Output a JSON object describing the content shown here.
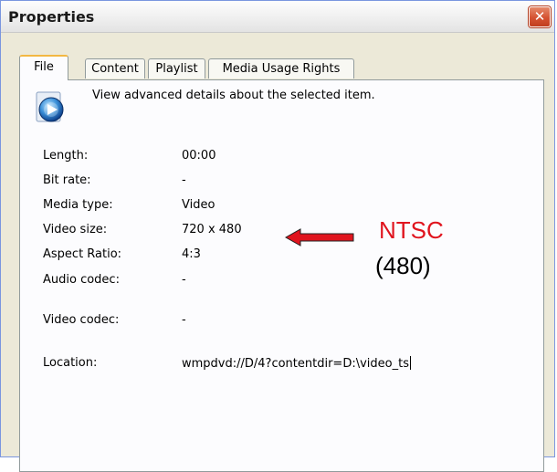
{
  "window": {
    "title": "Properties",
    "close_glyph": "✕"
  },
  "tabs": [
    {
      "label": "File",
      "active": true
    },
    {
      "label": "Content",
      "active": false
    },
    {
      "label": "Playlist",
      "active": false
    },
    {
      "label": "Media Usage Rights",
      "active": false
    }
  ],
  "header": {
    "icon": "windows-media-player-icon",
    "text": "View advanced details about the selected item."
  },
  "details": [
    {
      "label": "Length:",
      "value": "00:00"
    },
    {
      "label": "Bit rate:",
      "value": "-"
    },
    {
      "label": "Media type:",
      "value": "Video"
    },
    {
      "label": "Video size:",
      "value": "720 x 480"
    },
    {
      "label": "Aspect Ratio:",
      "value": "4:3"
    },
    {
      "label": "Audio codec:",
      "value": "-"
    },
    {
      "label": "Video codec:",
      "value": "-"
    },
    {
      "label": "Location:",
      "value": "wmpdvd://D/4?contentdir=D:\\video_ts"
    }
  ],
  "annotation": {
    "line1": "NTSC",
    "line2": "(480)",
    "arrow_color": "#e0141e"
  }
}
